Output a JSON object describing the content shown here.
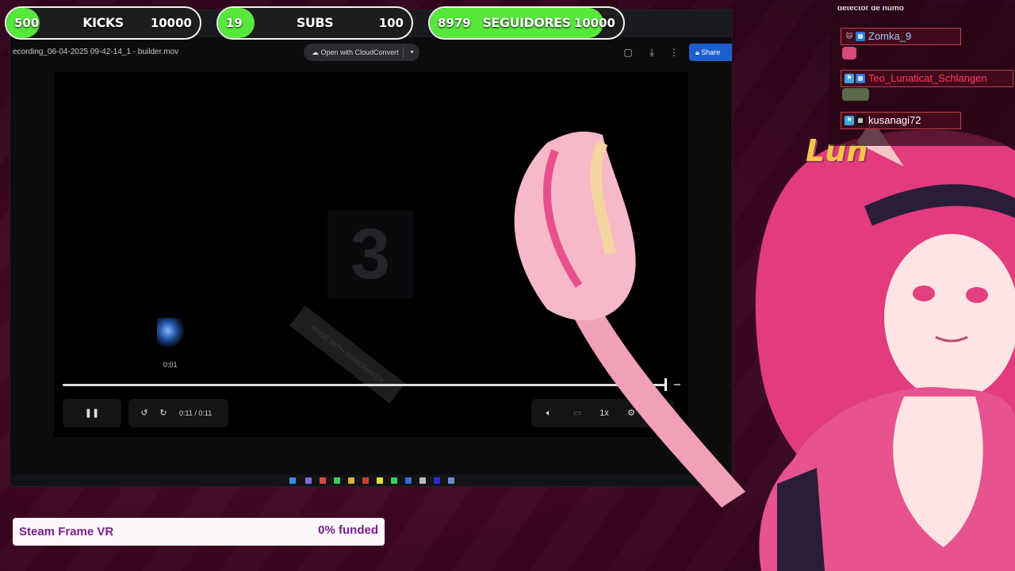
{
  "goals": [
    {
      "current": "500",
      "label": "KICKS",
      "max": "10000",
      "progress": 0.05,
      "color": "#57e83c"
    },
    {
      "current": "19",
      "label": "SUBS",
      "max": "100",
      "progress": 0.19,
      "color": "#57e83c"
    },
    {
      "current": "8979",
      "label": "SEGUIDORES",
      "max": "10000",
      "progress": 0.898,
      "color": "#57e83c"
    }
  ],
  "viewer": {
    "filename": "ecording_06-04-2025 09-42-14_1 - builder.mov",
    "open_with_label": "Open with CloudConvert",
    "share_label": "Share",
    "hover_time": "0:01",
    "time_display": "0:11 / 0:11",
    "speed_label": "1x",
    "progress": 0.99,
    "watermark_text": "MADE WITH INTROMAKER"
  },
  "chat": {
    "top_line": "detector de humo",
    "messages": [
      {
        "user": "Zomka_9",
        "color": "#9ad0ff"
      },
      {
        "user": "Teo_Lunaticat_Schlangen",
        "color": "#ff3b5c"
      },
      {
        "user": "kusanagi72",
        "color": "#ffffff"
      }
    ]
  },
  "overlay": {
    "name_sign": "Lun"
  },
  "funding": {
    "title": "Steam Frame VR",
    "percent_label": "0% funded",
    "progress": 0
  },
  "icons": {
    "pause": "pause-icon",
    "rewind": "rewind-icon",
    "forward": "forward-icon",
    "volume": "volume-icon",
    "captions": "captions-icon",
    "settings": "settings-icon"
  }
}
